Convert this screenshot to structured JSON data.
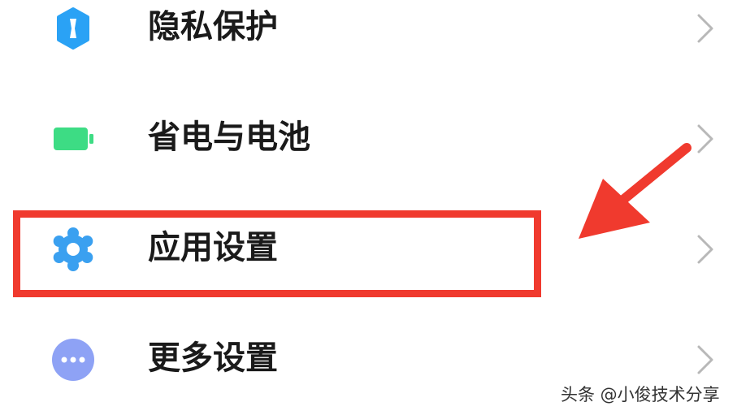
{
  "settings": {
    "items": [
      {
        "label": "隐私保护",
        "icon": "shield-icon"
      },
      {
        "label": "省电与电池",
        "icon": "battery-icon"
      },
      {
        "label": "应用设置",
        "icon": "gear-icon"
      },
      {
        "label": "更多设置",
        "icon": "more-dots-icon"
      }
    ]
  },
  "annotation": {
    "highlighted_item": "应用设置",
    "highlight_color": "#f03a2e"
  },
  "watermark": "头条 @小俊技术分享",
  "colors": {
    "privacy": "#2aa2f5",
    "battery": "#3ddc84",
    "apps": "#3aa0f0",
    "more": "#8ea2f5",
    "chevron": "#b8b8b8"
  }
}
